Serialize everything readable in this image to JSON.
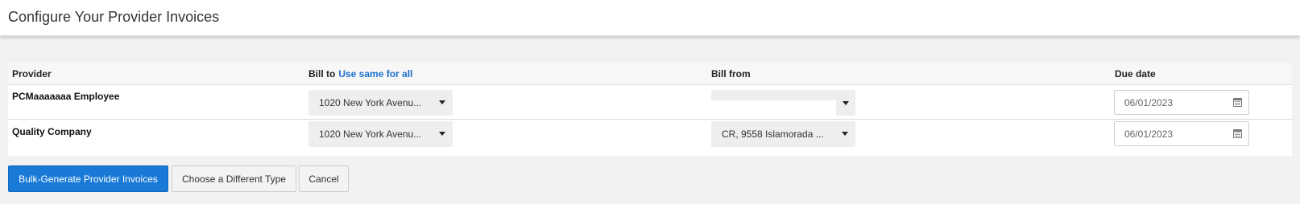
{
  "header": {
    "title": "Configure Your Provider Invoices"
  },
  "table": {
    "columns": {
      "provider": "Provider",
      "bill_to": "Bill to",
      "use_same_for_all": "Use same for all",
      "bill_from": "Bill from",
      "due_date": "Due date"
    },
    "rows": [
      {
        "provider": "PCMaaaaaaa Employee",
        "bill_to": "1020 New York Avenu...",
        "bill_from": "",
        "due_date": "06/01/2023"
      },
      {
        "provider": "Quality Company",
        "bill_to": "1020 New York Avenu...",
        "bill_from": "CR, 9558 Islamorada ...",
        "due_date": "06/01/2023"
      }
    ]
  },
  "actions": {
    "bulk_generate": "Bulk-Generate Provider Invoices",
    "choose_type": "Choose a Different Type",
    "cancel": "Cancel"
  },
  "colors": {
    "primary": "#1879d6",
    "link": "#1a6fd0",
    "background": "#f2f2f2"
  },
  "icons": [
    "chevron-down-icon",
    "calendar-icon"
  ]
}
